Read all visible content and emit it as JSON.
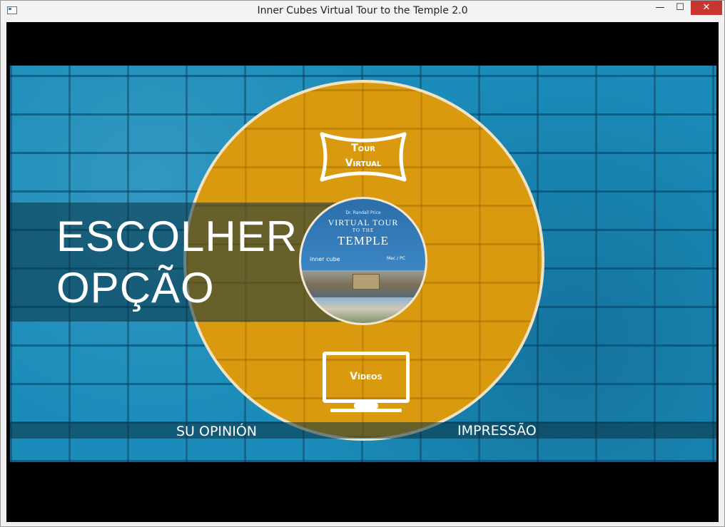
{
  "window": {
    "title": "Inner Cubes Virtual Tour to the Temple 2.0",
    "minimize_glyph": "—",
    "maximize_glyph": "☐",
    "close_glyph": "✕"
  },
  "menu": {
    "heading_line1": "ESCOLHER",
    "heading_line2": "OPÇÃO",
    "tour_line1": "Tour",
    "tour_line2": "Virtual",
    "videos_label": "Vídeos",
    "opinion_label": "SU OPINIÓN",
    "print_label": "IMPRESSÃO"
  },
  "disc": {
    "author": "Dr. Randall Price",
    "title_line1": "VIRTUAL TOUR",
    "title_line2": "TO THE",
    "title_line3": "TEMPLE",
    "brand": "inner cube",
    "format": "Mac / PC"
  },
  "colors": {
    "wall_blue": "#1b8cba",
    "circle_gold": "#d99a10",
    "close_red": "#c7372f"
  }
}
